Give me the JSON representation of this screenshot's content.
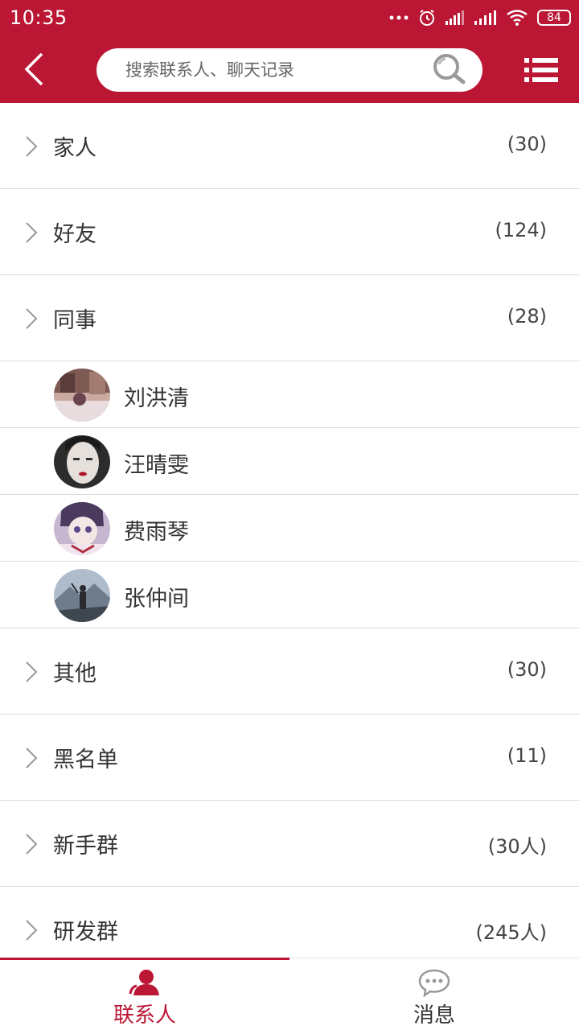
{
  "status_bar": {
    "time": "10:35",
    "battery": "84",
    "icons": [
      "more-dots-icon",
      "alarm-icon",
      "signal-icon",
      "signal-icon",
      "wifi-icon",
      "battery-icon"
    ]
  },
  "nav": {
    "back_icon": "chevron-left-icon",
    "search_placeholder": "搜索联系人、聊天记录",
    "search_icon": "search-icon",
    "menu_icon": "list-menu-icon"
  },
  "groups_top": [
    {
      "name": "家人",
      "count": "(30)"
    },
    {
      "name": "好友",
      "count": "(124)"
    },
    {
      "name": "同事",
      "count": "(28)",
      "expanded": true
    }
  ],
  "contacts": [
    {
      "name": "刘洪清"
    },
    {
      "name": "汪晴雯"
    },
    {
      "name": "费雨琴"
    },
    {
      "name": "张仲间"
    }
  ],
  "groups_bottom": [
    {
      "name": "其他",
      "count": "(30)"
    },
    {
      "name": "黑名单",
      "count": "(11)"
    },
    {
      "name": "新手群",
      "count": "(30人)"
    },
    {
      "name": "研发群",
      "count": "(245人)"
    }
  ],
  "tabs": [
    {
      "label": "联系人",
      "icon": "contacts-icon",
      "active": true
    },
    {
      "label": "消息",
      "icon": "chat-bubble-icon",
      "active": false
    }
  ],
  "colors": {
    "accent": "#bb1634",
    "text": "#333333",
    "divider": "#dcdcdc"
  }
}
